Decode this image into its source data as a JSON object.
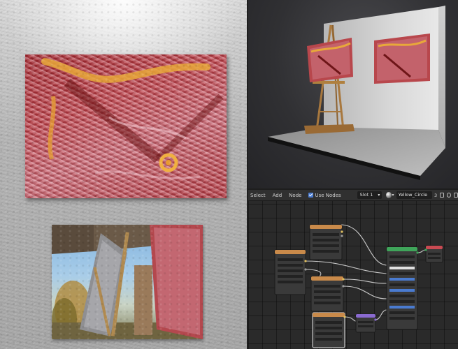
{
  "node_editor": {
    "menus": [
      "Select",
      "Add",
      "Node"
    ],
    "use_nodes_label": "Use Nodes",
    "use_nodes_checked": true,
    "slot_value": "Slot 1",
    "material_name": "Yellow_Circle",
    "user_count": "3"
  },
  "colors": {
    "painting_red": "#b8474c",
    "stroke_yellow": "#e8a83a",
    "node_orange_header": "#c98a4a",
    "node_green_header": "#3fa55a",
    "node_purple_header": "#8a6ad0",
    "node_red_header": "#c94a52",
    "link_color": "#c8c8c8",
    "checkbox_blue": "#4a7bd0"
  },
  "icons": [
    "checkbox-icon",
    "chevron-down-icon",
    "material-sphere-icon",
    "duplicate-icon",
    "delete-icon",
    "pin-icon"
  ]
}
